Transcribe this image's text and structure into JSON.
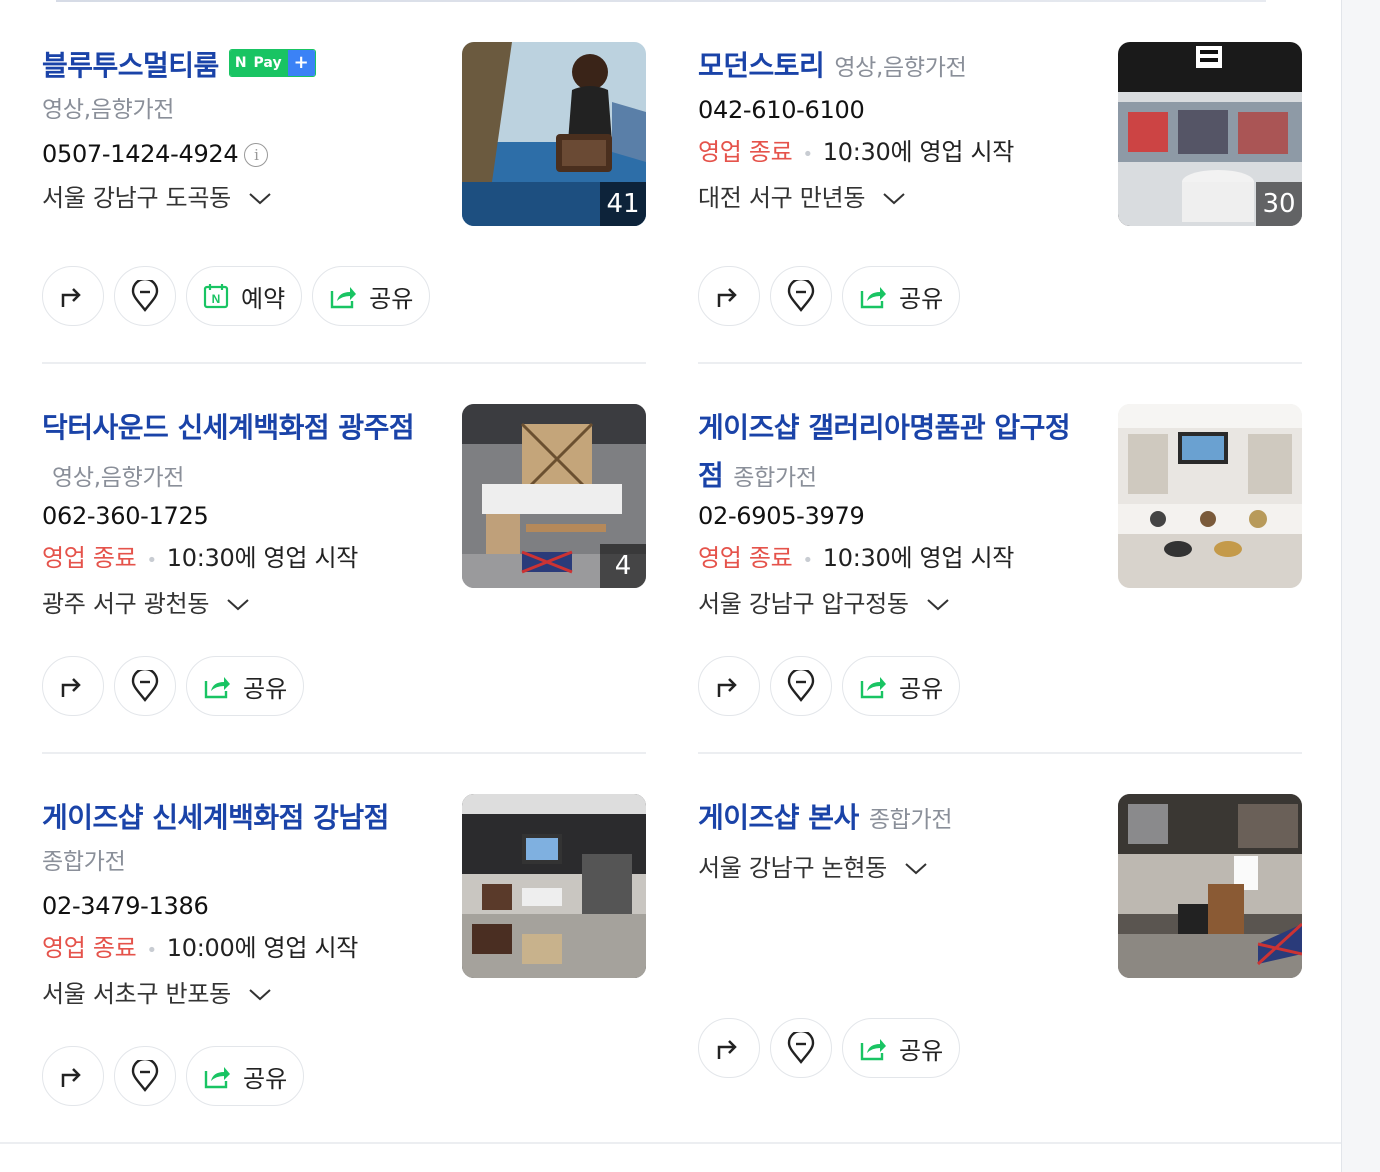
{
  "cards": [
    {
      "name": "블루투스멀티룸",
      "category": "영상,음향가전",
      "npay": {
        "n": "N",
        "pay": "Pay",
        "plus": "+"
      },
      "phone": "0507-1424-4924",
      "status": "",
      "hours": "",
      "address": "서울 강남구 도곡동",
      "photo_count": "41",
      "actions": {
        "directions": "",
        "map": "",
        "reserve": "예약",
        "share": "공유"
      }
    },
    {
      "name": "모던스토리",
      "category": "영상,음향가전",
      "phone": "042-610-6100",
      "status": "영업 종료",
      "hours": "10:30에 영업 시작",
      "address": "대전 서구 만년동",
      "photo_count": "30",
      "actions": {
        "share": "공유"
      }
    },
    {
      "name": "닥터사운드 신세계백화점 광주점",
      "category": "영상,음향가전",
      "phone": "062-360-1725",
      "status": "영업 종료",
      "hours": "10:30에 영업 시작",
      "address": "광주 서구 광천동",
      "photo_count": "4",
      "actions": {
        "share": "공유"
      }
    },
    {
      "name": "게이즈샵 갤러리아명품관 압구정점",
      "category": "종합가전",
      "phone": "02-6905-3979",
      "status": "영업 종료",
      "hours": "10:30에 영업 시작",
      "address": "서울 강남구 압구정동",
      "photo_count": "",
      "actions": {
        "share": "공유"
      }
    },
    {
      "name": "게이즈샵 신세계백화점 강남점",
      "category": "종합가전",
      "phone": "02-3479-1386",
      "status": "영업 종료",
      "hours": "10:00에 영업 시작",
      "address": "서울 서초구 반포동",
      "photo_count": "",
      "actions": {
        "share": "공유"
      }
    },
    {
      "name": "게이즈샵 본사",
      "category": "종합가전",
      "phone": "",
      "status": "",
      "hours": "",
      "address": "서울 강남구 논현동",
      "photo_count": "",
      "actions": {
        "share": "공유"
      }
    }
  ],
  "colors": {
    "title": "#1a43a8",
    "closed": "#e5534b",
    "category": "#8a8f99",
    "npay_green": "#19c463"
  },
  "icons": [
    "directions-icon",
    "map-pin-icon",
    "calendar-icon",
    "share-icon",
    "chevron-down-icon",
    "info-icon"
  ]
}
